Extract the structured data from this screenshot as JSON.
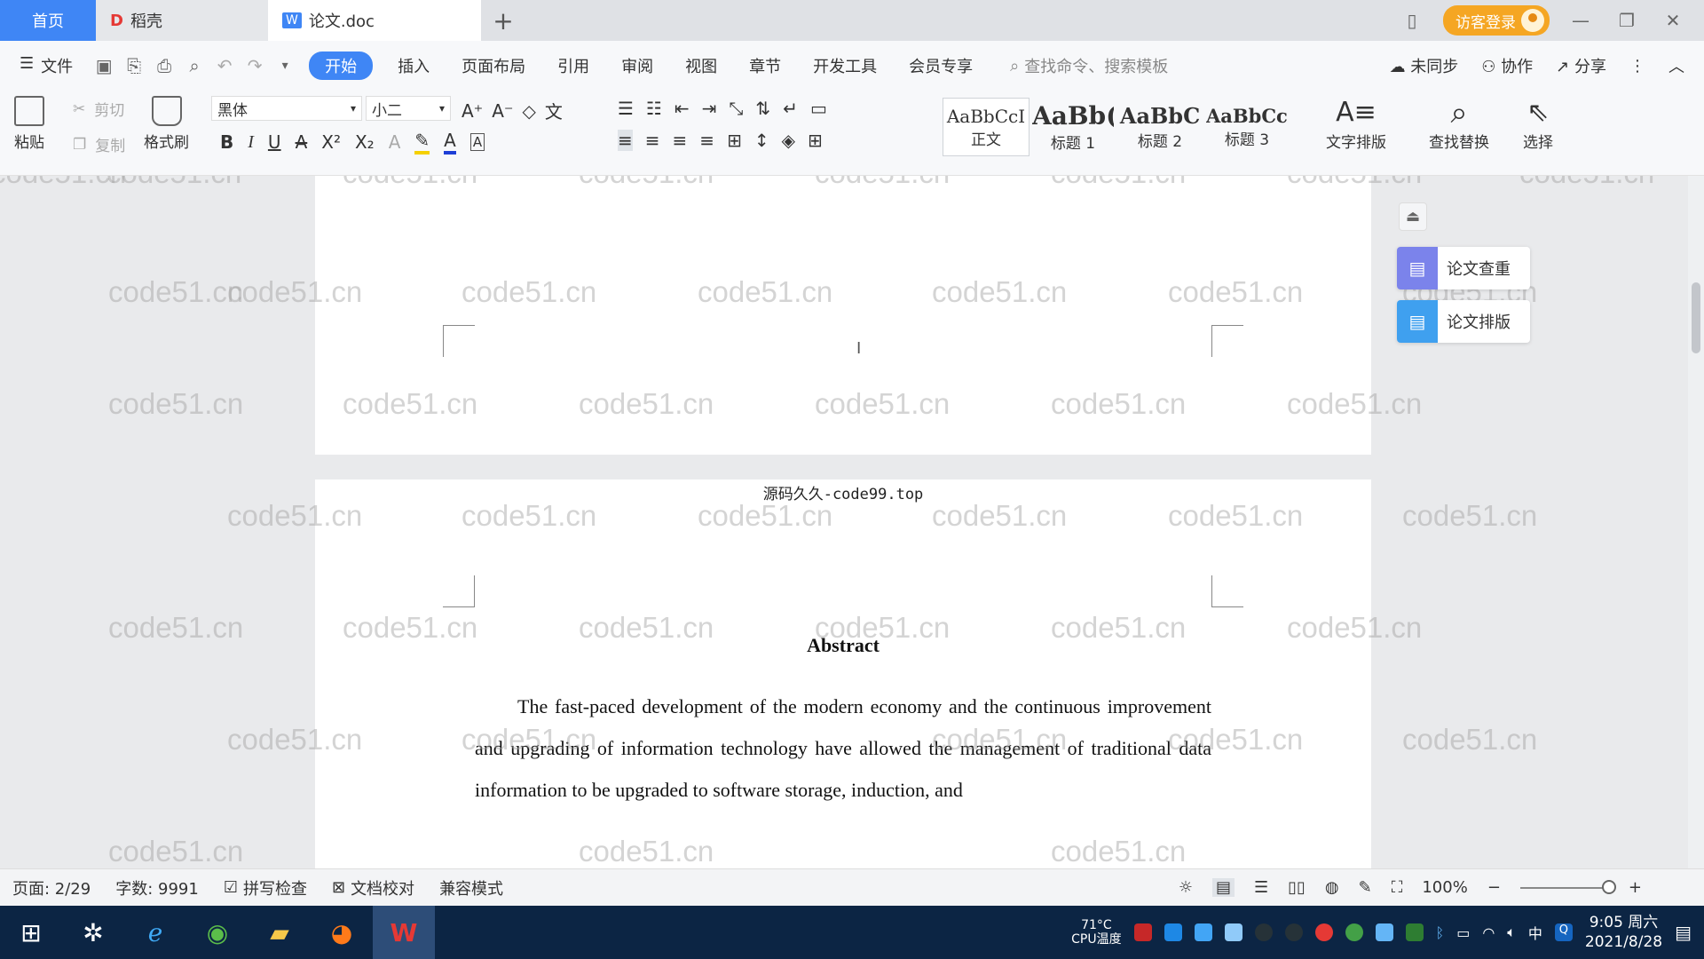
{
  "tabs": [
    {
      "label": "首页"
    },
    {
      "label": "稻壳"
    },
    {
      "label": "论文.doc"
    }
  ],
  "window": {
    "login_label": "访客登录"
  },
  "menubar": {
    "file_label": "文件",
    "items": [
      "开始",
      "插入",
      "页面布局",
      "引用",
      "审阅",
      "视图",
      "章节",
      "开发工具",
      "会员专享"
    ],
    "search_placeholder": "查找命令、搜索模板",
    "sync_label": "未同步",
    "collab_label": "协作",
    "share_label": "分享"
  },
  "ribbon": {
    "paste": "粘贴",
    "cut": "剪切",
    "copy": "复制",
    "format_painter": "格式刷",
    "font_name": "黑体",
    "font_size": "小二",
    "styles": [
      {
        "sample": "AaBbCcI",
        "name": "正文"
      },
      {
        "sample": "AaBb(",
        "name": "标题 1"
      },
      {
        "sample": "AaBbC",
        "name": "标题 2"
      },
      {
        "sample": "AaBbCcl",
        "name": "标题 3"
      }
    ],
    "text_layout": "文字排版",
    "find_replace": "查找替换",
    "select": "选择"
  },
  "document": {
    "page_header": "源码久久-code99.top",
    "heading": "Abstract",
    "paragraph": "The fast-paced development of the modern economy and the continuous improvement and upgrading of information technology have allowed the management of traditional data information to be upgraded to software storage, induction, and"
  },
  "watermark_text": "code51.cn",
  "side_panel": {
    "check_label": "论文查重",
    "layout_label": "论文排版"
  },
  "statusbar": {
    "page": "页面: 2/29",
    "words": "字数: 9991",
    "spell_check": "拼写检查",
    "proofread": "文档校对",
    "compat_mode": "兼容模式",
    "zoom": "100%"
  },
  "taskbar": {
    "cpu_temp": "71°C",
    "cpu_label": "CPU温度",
    "ime": "中",
    "time": "9:05 周六",
    "date": "2021/8/28"
  },
  "colors": {
    "accent": "#3f86f5",
    "login": "#f5a623",
    "taskbar": "#0c2544"
  }
}
